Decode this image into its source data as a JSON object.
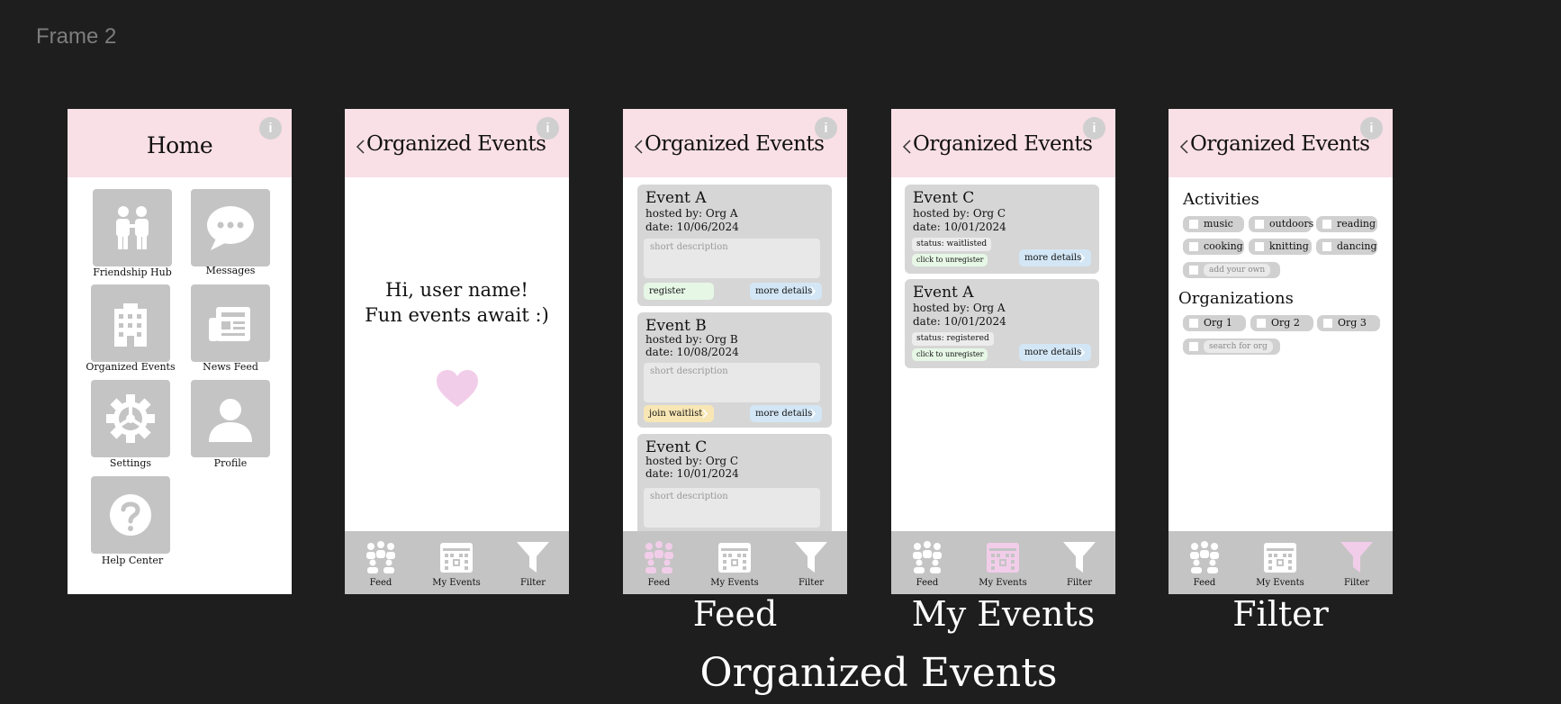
{
  "frame_label": "Frame 2",
  "colors": {
    "header_pink": "#f9dfe6",
    "tile_gray": "#c4c4c4",
    "card_gray": "#d6d6d6",
    "active_pink": "#f2cdea",
    "canvas": "#1e1e1e"
  },
  "home": {
    "title": "Home",
    "tiles": [
      {
        "label": "Friendship Hub",
        "icon": "family-icon"
      },
      {
        "label": "Messages",
        "icon": "chat-bubble-icon"
      },
      {
        "label": "Organized Events",
        "icon": "building-icon"
      },
      {
        "label": "News Feed",
        "icon": "newspaper-icon"
      },
      {
        "label": "Settings",
        "icon": "gear-icon"
      },
      {
        "label": "Profile",
        "icon": "person-icon"
      },
      {
        "label": "Help Center",
        "icon": "question-icon"
      }
    ]
  },
  "organized": {
    "title": "Organized Events",
    "info_label": "i",
    "greeting_line1": "Hi, user name!",
    "greeting_line2": "Fun events await :)"
  },
  "nav": {
    "feed": "Feed",
    "my_events": "My Events",
    "filter": "Filter"
  },
  "feed": {
    "events": [
      {
        "title": "Event A",
        "host": "hosted by: Org A",
        "date": "date: 10/06/2024",
        "desc": "short description",
        "action": "register",
        "details": "more details"
      },
      {
        "title": "Event B",
        "host": "hosted by: Org B",
        "date": "date: 10/08/2024",
        "desc": "short description",
        "action": "join waitlist",
        "details": "more details"
      },
      {
        "title": "Event C",
        "host": "hosted by: Org C",
        "date": "date: 10/01/2024",
        "desc": "short description"
      }
    ]
  },
  "my_events": {
    "events": [
      {
        "title": "Event C",
        "host": "hosted by: Org C",
        "date": "date: 10/01/2024",
        "status": "status: waitlisted",
        "unregister": "click to unregister",
        "details": "more details"
      },
      {
        "title": "Event A",
        "host": "hosted by: Org A",
        "date": "date: 10/01/2024",
        "status": "status: registered",
        "unregister": "click to unregister",
        "details": "more details"
      }
    ]
  },
  "filter": {
    "activities_title": "Activities",
    "activities": [
      "music",
      "outdoors",
      "reading",
      "cooking",
      "knitting",
      "dancing"
    ],
    "activities_placeholder": "add your own",
    "organizations_title": "Organizations",
    "organizations": [
      "Org 1",
      "Org 2",
      "Org 3"
    ],
    "organizations_placeholder": "search for org"
  },
  "captions": {
    "feed": "Feed",
    "my_events": "My Events",
    "filter": "Filter",
    "group": "Organized Events"
  }
}
